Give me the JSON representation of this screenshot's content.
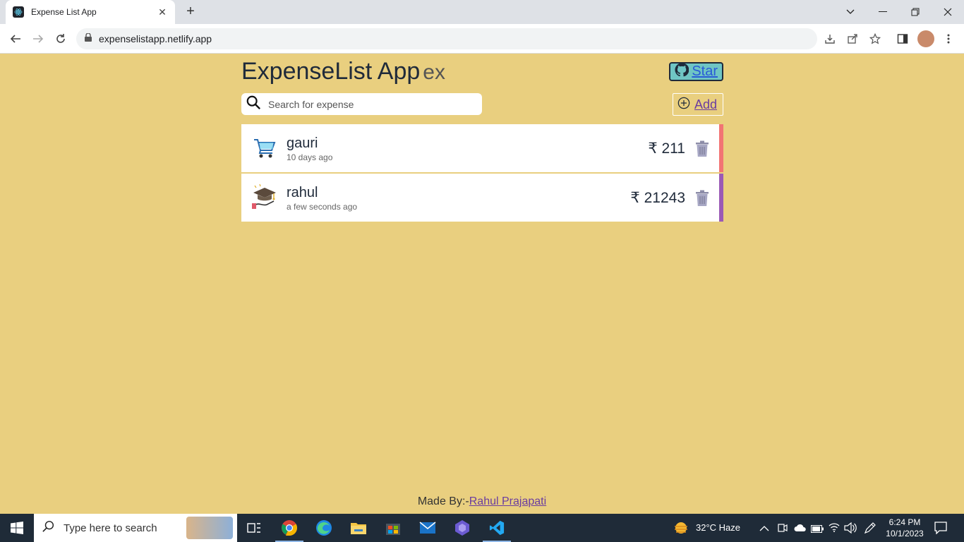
{
  "browser": {
    "tab_title": "Expense List App",
    "url": "expenselistapp.netlify.app"
  },
  "app": {
    "title": "ExpenseList App",
    "title_suffix": "ex",
    "star_label": "Star",
    "search_placeholder": "Search for expense",
    "add_label": "Add"
  },
  "expenses": [
    {
      "name": "gauri",
      "time": "10 days ago",
      "amount": "₹ 211",
      "icon": "shopping-cart-icon",
      "accent": "#f27474"
    },
    {
      "name": "rahul",
      "time": "a few seconds ago",
      "amount": "₹ 21243",
      "icon": "graduation-cap-icon",
      "accent": "#9b59b6"
    }
  ],
  "footer": {
    "prefix": "Made By:-",
    "author": "Rahul Prajapati"
  },
  "taskbar": {
    "search_text": "Type here to search",
    "weather": "32°C  Haze",
    "time": "6:24 PM",
    "date": "10/1/2023"
  }
}
